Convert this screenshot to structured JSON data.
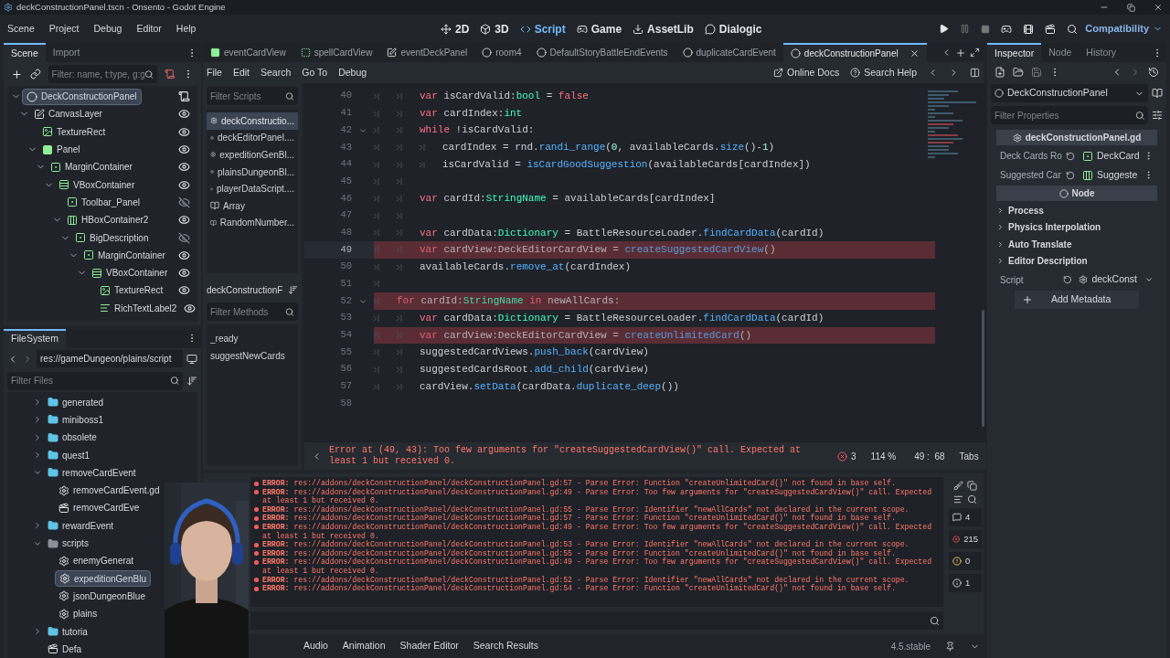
{
  "window": {
    "title": "deckConstructionPanel.tscn - Onsento - Godot Engine"
  },
  "menu": [
    "Scene",
    "Project",
    "Debug",
    "Editor",
    "Help"
  ],
  "workspaces": [
    {
      "label": "2D",
      "kind": "move",
      "selected": false
    },
    {
      "label": "3D",
      "kind": "cube",
      "selected": false
    },
    {
      "label": "Script",
      "kind": "code",
      "selected": true
    },
    {
      "label": "Game",
      "kind": "gamepad",
      "selected": false
    },
    {
      "label": "AssetLib",
      "kind": "download",
      "selected": false
    },
    {
      "label": "Dialogic",
      "kind": "chat",
      "selected": false
    }
  ],
  "renderer": "Compatibility",
  "scene_dock": {
    "tabs": [
      {
        "label": "Scene",
        "selected": true
      },
      {
        "label": "Import",
        "selected": false
      }
    ],
    "filter_placeholder": "Filter: name, t:type, g:g",
    "tree": [
      {
        "label": "DeckConstructionPanel",
        "kind": "node",
        "selected": true,
        "expanded": true,
        "children": [
          {
            "label": "CanvasLayer",
            "kind": "canvas_layer",
            "visible": true,
            "selected": false,
            "expanded": true,
            "children": [
              {
                "label": "TextureRect",
                "kind": "texture_rect",
                "visible": true,
                "selected": false
              },
              {
                "label": "Panel",
                "kind": "panel",
                "visible": true,
                "selected": false,
                "expanded": true,
                "children": [
                  {
                    "label": "MarginContainer",
                    "kind": "margin",
                    "visible": true,
                    "selected": false,
                    "expanded": true,
                    "children": [
                      {
                        "label": "VBoxContainer",
                        "kind": "vbox",
                        "visible": true,
                        "selected": false,
                        "expanded": true,
                        "children": [
                          {
                            "label": "Toolbar_Panel",
                            "kind": "margin",
                            "visible": false,
                            "selected": false
                          },
                          {
                            "label": "HBoxContainer2",
                            "kind": "hbox",
                            "visible": true,
                            "selected": false,
                            "expanded": true,
                            "children": [
                              {
                                "label": "BigDescription",
                                "kind": "margin",
                                "visible": false,
                                "selected": false,
                                "expanded": true,
                                "children": [
                                  {
                                    "label": "MarginContainer",
                                    "kind": "margin",
                                    "visible": true,
                                    "selected": false,
                                    "expanded": true,
                                    "children": [
                                      {
                                        "label": "VBoxContainer",
                                        "kind": "vbox",
                                        "visible": true,
                                        "selected": false,
                                        "expanded": true,
                                        "children": [
                                          {
                                            "label": "TextureRect",
                                            "kind": "texture_rect",
                                            "visible": true,
                                            "selected": false
                                          },
                                          {
                                            "label": "RichTextLabel2",
                                            "kind": "rich_text",
                                            "visible": true,
                                            "selected": false
                                          }
                                        ]
                                      }
                                    ]
                                  }
                                ]
                              }
                            ]
                          }
                        ]
                      }
                    ]
                  }
                ]
              }
            ]
          }
        ]
      }
    ]
  },
  "filesystem": {
    "title": "FileSystem",
    "path": "res://gameDungeon/plains/script",
    "filter_placeholder": "Filter Files",
    "tree": [
      {
        "label": "generated",
        "kind": "folder",
        "color": "#5fc4e6",
        "expanded": false,
        "selected": false
      },
      {
        "label": "miniboss1",
        "kind": "folder",
        "color": "#5fc4e6",
        "expanded": false,
        "selected": false
      },
      {
        "label": "obsolete",
        "kind": "folder",
        "color": "#5fc4e6",
        "expanded": false,
        "selected": false
      },
      {
        "label": "quest1",
        "kind": "folder",
        "color": "#5fc4e6",
        "expanded": false,
        "selected": false
      },
      {
        "label": "removeCardEvent",
        "kind": "folder",
        "color": "#5fc4e6",
        "expanded": true,
        "selected": false,
        "children": [
          {
            "label": "removeCardEvent.gd",
            "kind": "script",
            "selected": false
          },
          {
            "label": "removeCardEve",
            "kind": "scene",
            "selected": false
          }
        ]
      },
      {
        "label": "rewardEvent",
        "kind": "folder",
        "color": "#5fc4e6",
        "expanded": false,
        "selected": false
      },
      {
        "label": "scripts",
        "kind": "folder",
        "color": "#8b9098",
        "expanded": true,
        "selected": false,
        "children": [
          {
            "label": "enemyGenerat",
            "kind": "script",
            "selected": false
          },
          {
            "label": "expeditionGenBlu",
            "kind": "script",
            "selected": true
          },
          {
            "label": "jsonDungeonBlue",
            "kind": "script",
            "selected": false
          },
          {
            "label": "plains",
            "kind": "script",
            "selected": false
          }
        ]
      },
      {
        "label": "tutoria",
        "kind": "folder",
        "color": "#5fc4e6",
        "expanded": false,
        "selected": false
      },
      {
        "label": "Defa",
        "kind": "scene",
        "selected": false
      }
    ]
  },
  "editor_tabs": [
    {
      "label": "eventCardView",
      "kind": "panel",
      "selected": false
    },
    {
      "label": "spellCardView",
      "kind": "dotted",
      "selected": false
    },
    {
      "label": "eventDeckPanel",
      "kind": "canvas_layer",
      "selected": false
    },
    {
      "label": "room4",
      "kind": "node",
      "selected": false
    },
    {
      "label": "DefaultStoryBattleEndEvents",
      "kind": "node",
      "selected": false
    },
    {
      "label": "duplicateCardEvent",
      "kind": "node",
      "selected": false
    },
    {
      "label": "deckConstructionPanel",
      "kind": "node",
      "selected": true
    }
  ],
  "script_menu": [
    "File",
    "Edit",
    "Search",
    "Go To",
    "Debug"
  ],
  "help_links": [
    {
      "label": "Online Docs",
      "kind": "docs"
    },
    {
      "label": "Search Help",
      "kind": "help"
    }
  ],
  "scripts": {
    "filter_placeholder": "Filter Scripts",
    "items": [
      {
        "label": "deckConstructio...",
        "kind": "script",
        "selected": true
      },
      {
        "label": "deckEditorPanel....",
        "kind": "script",
        "selected": false
      },
      {
        "label": "expeditionGenBl...",
        "kind": "script",
        "selected": false
      },
      {
        "label": "plainsDungeonBl...",
        "kind": "script",
        "selected": false
      },
      {
        "label": "playerDataScript....",
        "kind": "script",
        "selected": false
      },
      {
        "label": "Array",
        "kind": "class",
        "selected": false
      },
      {
        "label": "RandomNumber...",
        "kind": "class",
        "selected": false
      }
    ],
    "current": "deckConstructionF",
    "methods_placeholder": "Filter Methods",
    "methods": [
      "_ready",
      "suggestNewCards"
    ]
  },
  "code": {
    "lines": [
      {
        "number": "40",
        "guides": [
          {
            "kind": "tab"
          },
          {
            "kind": "tab"
          }
        ],
        "fold": false,
        "error": false,
        "current": false,
        "tokens": [
          {
            "kind": "keyword",
            "text": "var "
          },
          {
            "kind": "plain",
            "text": "isCardValid:"
          },
          {
            "kind": "type",
            "text": "bool"
          },
          {
            "kind": "plain",
            "text": " = "
          },
          {
            "kind": "keyword",
            "text": "false"
          }
        ]
      },
      {
        "number": "41",
        "guides": [
          {
            "kind": "tab"
          },
          {
            "kind": "tab"
          }
        ],
        "fold": false,
        "error": false,
        "current": false,
        "tokens": [
          {
            "kind": "keyword",
            "text": "var "
          },
          {
            "kind": "plain",
            "text": "cardIndex:"
          },
          {
            "kind": "type",
            "text": "int"
          }
        ]
      },
      {
        "number": "42",
        "guides": [
          {
            "kind": "tab"
          },
          {
            "kind": "tab"
          }
        ],
        "fold": true,
        "error": false,
        "current": false,
        "tokens": [
          {
            "kind": "keyword",
            "text": "while "
          },
          {
            "kind": "plain",
            "text": "!isCardValid:"
          }
        ]
      },
      {
        "number": "43",
        "guides": [
          {
            "kind": "tab"
          },
          {
            "kind": "tab"
          },
          {
            "kind": "tab"
          }
        ],
        "fold": false,
        "error": false,
        "current": false,
        "tokens": [
          {
            "kind": "plain",
            "text": "cardIndex = rnd."
          },
          {
            "kind": "function",
            "text": "randi_range"
          },
          {
            "kind": "plain",
            "text": "("
          },
          {
            "kind": "number",
            "text": "0"
          },
          {
            "kind": "plain",
            "text": ", availableCards."
          },
          {
            "kind": "function",
            "text": "size"
          },
          {
            "kind": "plain",
            "text": "()-"
          },
          {
            "kind": "number",
            "text": "1"
          },
          {
            "kind": "plain",
            "text": ")"
          }
        ]
      },
      {
        "number": "44",
        "guides": [
          {
            "kind": "tab"
          },
          {
            "kind": "tab"
          },
          {
            "kind": "tab"
          }
        ],
        "fold": false,
        "error": false,
        "current": false,
        "tokens": [
          {
            "kind": "plain",
            "text": "isCardValid = "
          },
          {
            "kind": "function",
            "text": "isCardGoodSuggestion"
          },
          {
            "kind": "plain",
            "text": "(availableCards[cardIndex])"
          }
        ]
      },
      {
        "number": "45",
        "guides": [
          {
            "kind": "tab"
          },
          {
            "kind": "tab"
          }
        ],
        "fold": false,
        "error": false,
        "current": false
      },
      {
        "number": "46",
        "guides": [
          {
            "kind": "tab"
          },
          {
            "kind": "tab"
          }
        ],
        "fold": false,
        "error": false,
        "current": false,
        "tokens": [
          {
            "kind": "keyword",
            "text": "var "
          },
          {
            "kind": "plain",
            "text": "cardId:"
          },
          {
            "kind": "type",
            "text": "StringName"
          },
          {
            "kind": "plain",
            "text": " = availableCards[cardIndex]"
          }
        ]
      },
      {
        "number": "47",
        "guides": [
          {
            "kind": "tab"
          },
          {
            "kind": "tab"
          }
        ],
        "fold": false,
        "error": false,
        "current": false
      },
      {
        "number": "48",
        "guides": [
          {
            "kind": "tab"
          },
          {
            "kind": "tab"
          }
        ],
        "fold": false,
        "error": false,
        "current": false,
        "tokens": [
          {
            "kind": "keyword",
            "text": "var "
          },
          {
            "kind": "plain",
            "text": "cardData:"
          },
          {
            "kind": "type",
            "text": "Dictionary"
          },
          {
            "kind": "plain",
            "text": " = BattleResourceLoader."
          },
          {
            "kind": "function",
            "text": "findCardData"
          },
          {
            "kind": "plain",
            "text": "(cardId)"
          }
        ]
      },
      {
        "number": "49",
        "guides": [
          {
            "kind": "tab"
          },
          {
            "kind": "tab"
          }
        ],
        "fold": false,
        "error": true,
        "current": true,
        "tokens": [
          {
            "kind": "keyword",
            "text": "var "
          },
          {
            "kind": "plain",
            "text": "cardView:DeckEditorCardView = "
          },
          {
            "kind": "function",
            "text": "createSuggestedCardView"
          },
          {
            "kind": "plain",
            "text": "()"
          }
        ]
      },
      {
        "number": "50",
        "guides": [
          {
            "kind": "tab"
          },
          {
            "kind": "tab"
          }
        ],
        "fold": false,
        "error": false,
        "current": false,
        "tokens": [
          {
            "kind": "plain",
            "text": "availableCards."
          },
          {
            "kind": "function",
            "text": "remove_at"
          },
          {
            "kind": "plain",
            "text": "(cardIndex)"
          }
        ]
      },
      {
        "number": "51",
        "guides": [
          {
            "kind": "tab"
          }
        ],
        "fold": false,
        "error": false,
        "current": false
      },
      {
        "number": "52",
        "guides": [
          {
            "kind": "tab"
          }
        ],
        "fold": true,
        "error": true,
        "current": false,
        "tokens": [
          {
            "kind": "keyword",
            "text": "for "
          },
          {
            "kind": "plain",
            "text": "cardId:"
          },
          {
            "kind": "type",
            "text": "StringName"
          },
          {
            "kind": "keyword",
            "text": " in "
          },
          {
            "kind": "plain",
            "text": "newAllCards:"
          }
        ]
      },
      {
        "number": "53",
        "guides": [
          {
            "kind": "tab"
          },
          {
            "kind": "tab"
          }
        ],
        "fold": false,
        "error": false,
        "current": false,
        "tokens": [
          {
            "kind": "keyword",
            "text": "var "
          },
          {
            "kind": "plain",
            "text": "cardData:"
          },
          {
            "kind": "type",
            "text": "Dictionary"
          },
          {
            "kind": "plain",
            "text": " = BattleResourceLoader."
          },
          {
            "kind": "function",
            "text": "findCardData"
          },
          {
            "kind": "plain",
            "text": "(cardId)"
          }
        ]
      },
      {
        "number": "54",
        "guides": [
          {
            "kind": "tab"
          },
          {
            "kind": "tab"
          }
        ],
        "fold": false,
        "error": true,
        "current": false,
        "tokens": [
          {
            "kind": "keyword",
            "text": "var "
          },
          {
            "kind": "plain",
            "text": "cardView:DeckEditorCardView = "
          },
          {
            "kind": "function",
            "text": "createUnlimitedCard"
          },
          {
            "kind": "plain",
            "text": "()"
          }
        ]
      },
      {
        "number": "55",
        "guides": [
          {
            "kind": "tab"
          },
          {
            "kind": "tab"
          }
        ],
        "fold": false,
        "error": false,
        "current": false,
        "tokens": [
          {
            "kind": "plain",
            "text": "suggestedCardViews."
          },
          {
            "kind": "function",
            "text": "push_back"
          },
          {
            "kind": "plain",
            "text": "(cardView)"
          }
        ]
      },
      {
        "number": "56",
        "guides": [
          {
            "kind": "tab"
          },
          {
            "kind": "tab"
          }
        ],
        "fold": false,
        "error": false,
        "current": false,
        "tokens": [
          {
            "kind": "plain",
            "text": "suggestedCardsRoot."
          },
          {
            "kind": "function",
            "text": "add_child"
          },
          {
            "kind": "plain",
            "text": "(cardView)"
          }
        ]
      },
      {
        "number": "57",
        "guides": [
          {
            "kind": "tab"
          },
          {
            "kind": "tab"
          }
        ],
        "fold": false,
        "error": false,
        "current": false,
        "tokens": [
          {
            "kind": "plain",
            "text": "cardView."
          },
          {
            "kind": "function",
            "text": "setData"
          },
          {
            "kind": "plain",
            "text": "(cardData."
          },
          {
            "kind": "function",
            "text": "duplicate_deep"
          },
          {
            "kind": "plain",
            "text": "())"
          }
        ]
      },
      {
        "number": "58",
        "fold": false,
        "error": false,
        "current": false
      }
    ],
    "error_message": "Error at (49, 43): Too few arguments for \"createSuggestedCardView()\" call. Expected at least 1 but received 0.",
    "error_count": "3",
    "zoom": "114 %",
    "position": "49 :  68",
    "indent_mode": "Tabs"
  },
  "output": {
    "lines": [
      {
        "kind": "error",
        "prefix": "ERROR:",
        "text": "res://addons/deckConstructionPanel/deckConstructionPanel.gd:57 - Parse Error: Function \"createUnlimitedCard()\" not found in base self."
      },
      {
        "kind": "error",
        "prefix": "ERROR:",
        "text": "res://addons/deckConstructionPanel/deckConstructionPanel.gd:49 - Parse Error: Too few arguments for \"createSuggestedCardView()\" call. Expected at least 1 but received 0."
      },
      {
        "kind": "error",
        "prefix": "ERROR:",
        "text": "res://addons/deckConstructionPanel/deckConstructionPanel.gd:55 - Parse Error: Identifier \"newAllCards\" not declared in the current scope."
      },
      {
        "kind": "error",
        "prefix": "ERROR:",
        "text": "res://addons/deckConstructionPanel/deckConstructionPanel.gd:57 - Parse Error: Function \"createUnlimitedCard()\" not found in base self."
      },
      {
        "kind": "error",
        "prefix": "ERROR:",
        "text": "res://addons/deckConstructionPanel/deckConstructionPanel.gd:49 - Parse Error: Too few arguments for \"createSuggestedCardView()\" call. Expected at least 1 but received 0."
      },
      {
        "kind": "error",
        "prefix": "ERROR:",
        "text": "res://addons/deckConstructionPanel/deckConstructionPanel.gd:53 - Parse Error: Identifier \"newAllCards\" not declared in the current scope."
      },
      {
        "kind": "error",
        "prefix": "ERROR:",
        "text": "res://addons/deckConstructionPanel/deckConstructionPanel.gd:55 - Parse Error: Function \"createUnlimitedCard()\" not found in base self."
      },
      {
        "kind": "error",
        "prefix": "ERROR:",
        "text": "res://addons/deckConstructionPanel/deckConstructionPanel.gd:49 - Parse Error: Too few arguments for \"createSuggestedCardView()\" call. Expected at least 1 but received 0."
      },
      {
        "kind": "error",
        "prefix": "ERROR:",
        "text": "res://addons/deckConstructionPanel/deckConstructionPanel.gd:52 - Parse Error: Identifier \"newAllCards\" not declared in the current scope."
      },
      {
        "kind": "error",
        "prefix": "ERROR:",
        "text": "res://addons/deckConstructionPanel/deckConstructionPanel.gd:54 - Parse Error: Function \"createUnlimitedCard()\" not found in base self."
      }
    ],
    "filters": [
      {
        "kind": "message",
        "count": "4"
      },
      {
        "kind": "error",
        "count": "215"
      },
      {
        "kind": "warning",
        "count": "0"
      },
      {
        "kind": "editor",
        "count": "1"
      }
    ]
  },
  "bottom_tabs": [
    "Audio",
    "Animation",
    "Shader Editor",
    "Search Results"
  ],
  "version": "4.5.stable",
  "webcam": {
    "kind": "picture"
  },
  "inspector": {
    "tabs": [
      {
        "label": "Inspector",
        "selected": true
      },
      {
        "label": "Node",
        "selected": false
      },
      {
        "label": "History",
        "selected": false
      }
    ],
    "node": "DeckConstructionPanel",
    "filter_placeholder": "Filter Properties",
    "script_section": "deckConstructionPanel.gd",
    "properties": [
      {
        "label": "Deck Cards Ro",
        "value": "DeckCard",
        "kind": "margin"
      },
      {
        "label": "Suggested Car",
        "value": "Suggeste",
        "kind": "hbox"
      }
    ],
    "node_section": "Node",
    "groups": [
      "Process",
      "Physics Interpolation",
      "Auto Translate",
      "Editor Description"
    ],
    "script_label": "Script",
    "script_value": "deckConst",
    "add_button": "Add Metadata"
  }
}
